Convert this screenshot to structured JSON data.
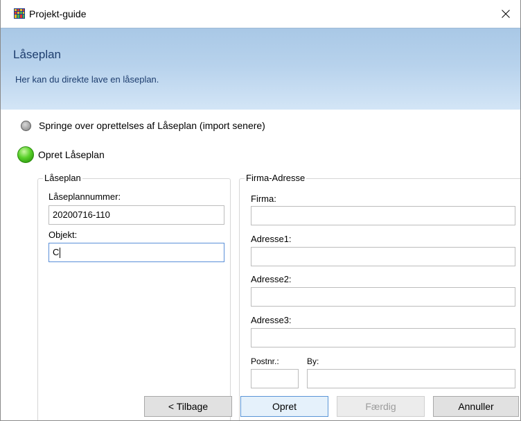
{
  "window": {
    "title": "Projekt-guide",
    "icon": "app-grid-icon",
    "close_icon": "close-icon"
  },
  "banner": {
    "title": "Låseplan",
    "subtitle": "Her kan du direkte lave en låseplan."
  },
  "options": {
    "skip_label": "Springe over oprettelses af Låseplan (import senere)",
    "create_label": "Opret Låseplan",
    "selected": "create"
  },
  "laaseplan_group": {
    "legend": "Låseplan",
    "number_label": "Låseplannummer:",
    "number_value": "20200716-110",
    "object_label": "Objekt:",
    "object_value": "C"
  },
  "firma_group": {
    "legend": "Firma-Adresse",
    "firma_label": "Firma:",
    "firma_value": "",
    "adresse1_label": "Adresse1:",
    "adresse1_value": "",
    "adresse2_label": "Adresse2:",
    "adresse2_value": "",
    "adresse3_label": "Adresse3:",
    "adresse3_value": "",
    "postnr_label": "Postnr.:",
    "postnr_value": "",
    "by_label": "By:",
    "by_value": ""
  },
  "buttons": {
    "back": "< Tilbage",
    "create": "Opret",
    "finish": "Færdig",
    "cancel": "Annuller"
  },
  "colors": {
    "banner_text": "#1d3d6e",
    "focus_border": "#5a8fd8"
  }
}
